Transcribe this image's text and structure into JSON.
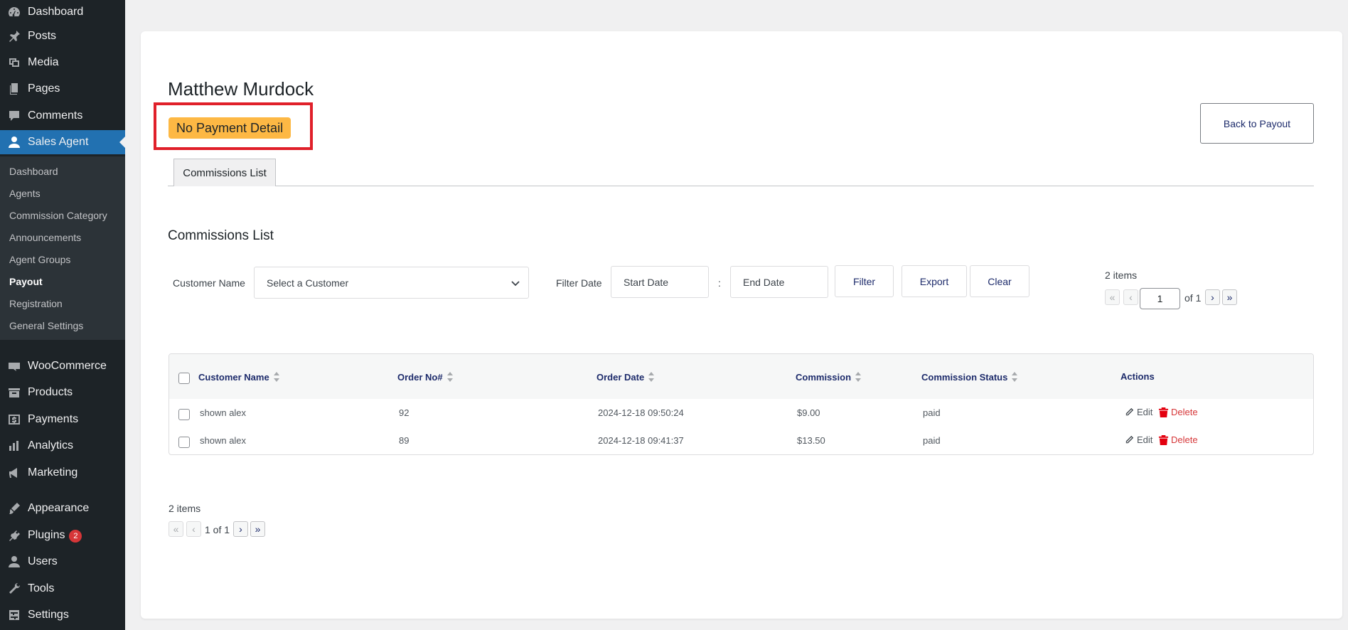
{
  "sidebar": {
    "items": [
      {
        "label": "Dashboard",
        "icon": "dashboard-icon"
      },
      {
        "label": "Posts",
        "icon": "pin-icon"
      },
      {
        "label": "Media",
        "icon": "media-icon"
      },
      {
        "label": "Pages",
        "icon": "pages-icon"
      },
      {
        "label": "Comments",
        "icon": "comment-icon"
      },
      {
        "label": "Sales Agent",
        "icon": "user-icon"
      },
      {
        "label": "WooCommerce",
        "icon": "woo-icon"
      },
      {
        "label": "Products",
        "icon": "archive-icon"
      },
      {
        "label": "Payments",
        "icon": "dollar-icon"
      },
      {
        "label": "Analytics",
        "icon": "bar-chart-icon"
      },
      {
        "label": "Marketing",
        "icon": "megaphone-icon"
      },
      {
        "label": "Appearance",
        "icon": "brush-icon"
      },
      {
        "label": "Plugins",
        "icon": "plugin-icon",
        "badge": "2"
      },
      {
        "label": "Users",
        "icon": "users-icon"
      },
      {
        "label": "Tools",
        "icon": "wrench-icon"
      },
      {
        "label": "Settings",
        "icon": "settings-icon"
      }
    ],
    "submenu": [
      "Dashboard",
      "Agents",
      "Commission Category",
      "Announcements",
      "Agent Groups",
      "Payout",
      "Registration",
      "General Settings"
    ]
  },
  "header": {
    "agent_name": "Matthew Murdock",
    "payment_badge": "No Payment Detail",
    "back_button": "Back to Payout"
  },
  "tabs": [
    {
      "label": "Commissions List"
    }
  ],
  "section_title": "Commissions List",
  "filters": {
    "customer_label": "Customer Name",
    "customer_placeholder": "Select a Customer",
    "date_label": "Filter Date",
    "start_placeholder": "Start Date",
    "separator": ":",
    "end_placeholder": "End Date",
    "filter_button": "Filter",
    "export_button": "Export",
    "clear_button": "Clear"
  },
  "pagination_top": {
    "items": "2 items",
    "first": "«",
    "prev": "‹",
    "current_page": "1",
    "of_text": "of 1",
    "next": "›",
    "last": "»"
  },
  "table": {
    "columns": [
      "Customer Name",
      "Order No#",
      "Order Date",
      "Commission",
      "Commission Status",
      "Actions"
    ],
    "rows": [
      {
        "customer": "shown alex",
        "order_no": "92",
        "order_date": "2024-12-18 09:50:24",
        "commission": "$9.00",
        "status": "paid"
      },
      {
        "customer": "shown alex",
        "order_no": "89",
        "order_date": "2024-12-18 09:41:37",
        "commission": "$13.50",
        "status": "paid"
      }
    ],
    "edit_label": "Edit",
    "delete_label": "Delete"
  },
  "pagination_bottom": {
    "items": "2 items",
    "first": "«",
    "prev": "‹",
    "page_text": "1 of 1",
    "next": "›",
    "last": "»"
  },
  "colors": {
    "sidebar_bg": "#1d2327",
    "active_menu": "#2271b1",
    "badge_bg": "#fdb844",
    "highlight": "#e0202a",
    "delete_red": "#d63638"
  }
}
